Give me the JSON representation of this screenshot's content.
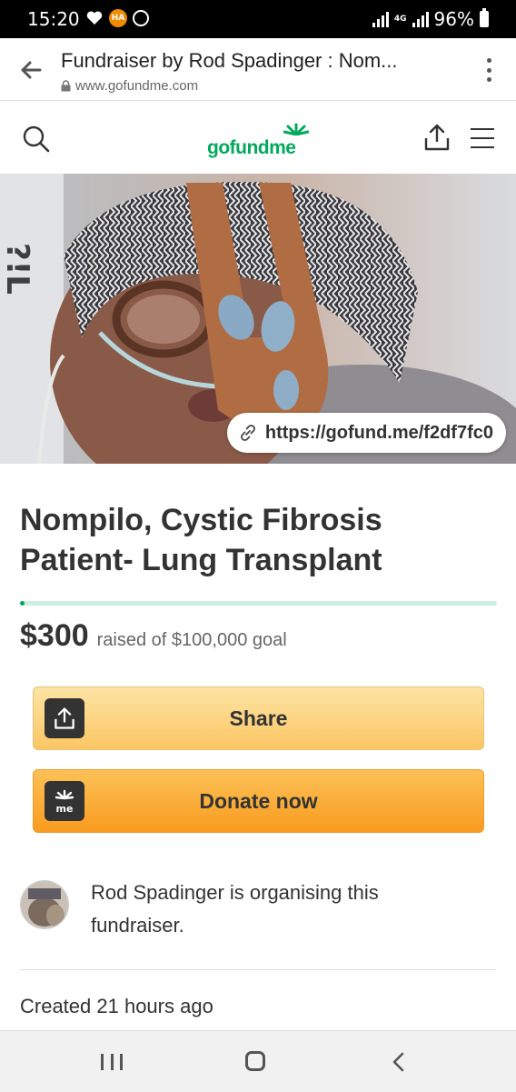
{
  "status_bar": {
    "time": "15:20",
    "battery": "96%",
    "network": "4G",
    "icons": [
      "heart-icon",
      "ha-app-icon",
      "messenger-icon",
      "signal-icon",
      "battery-icon"
    ]
  },
  "browser": {
    "page_title": "Fundraiser by Rod Spadinger : Nom...",
    "url": "www.gofundme.com",
    "icons": [
      "back-arrow-icon",
      "lock-icon",
      "more-vert-icon"
    ]
  },
  "header": {
    "logo": "gofundme",
    "icons": [
      "search-icon",
      "share-icon",
      "menu-icon"
    ]
  },
  "hero": {
    "short_link": "https://gofund.me/f2df7fc0"
  },
  "campaign": {
    "title": "Nompilo, Cystic Fibrosis Patient- Lung Transplant",
    "raised": "$300",
    "goal_text": "raised of $100,000 goal",
    "progress_fraction": 0.003
  },
  "actions": {
    "share_label": "Share",
    "donate_label": "Donate now"
  },
  "organiser": {
    "text": "Rod Spadinger is organising this fundraiser."
  },
  "meta": {
    "created": "Created 21 hours ago"
  },
  "colors": {
    "brand_green": "#02a95c",
    "donate_orange": "#f99b1f",
    "share_yellow": "#fbc664"
  }
}
